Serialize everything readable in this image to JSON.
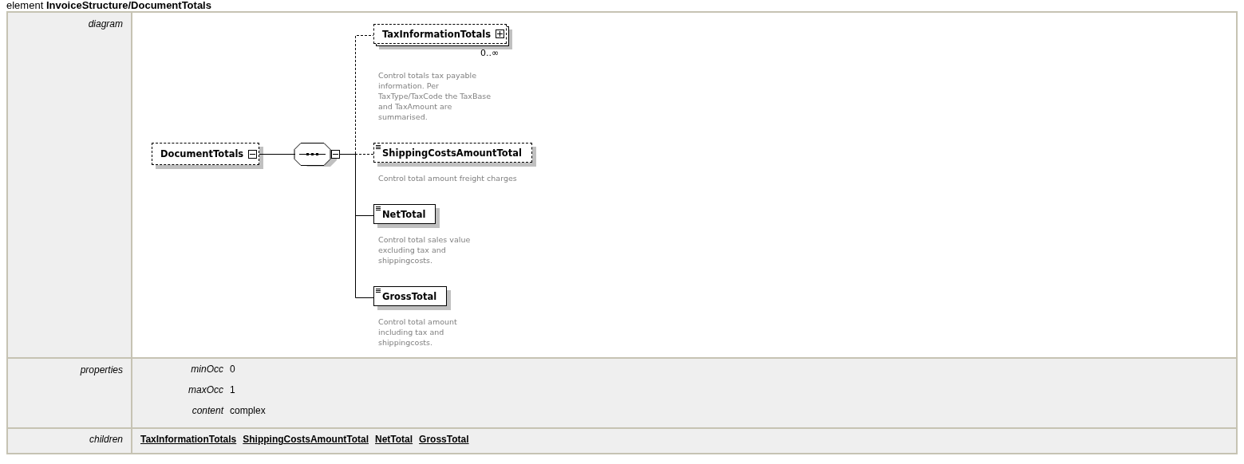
{
  "heading": {
    "prefix": "element",
    "path": "InvoiceStructure/DocumentTotals"
  },
  "diagram": {
    "label": "diagram",
    "root": {
      "name": "DocumentTotals",
      "optional": true,
      "expanded": true
    },
    "compositor": {
      "kind": "sequence",
      "expanded": true
    },
    "children": [
      {
        "name": "TaxInformationTotals",
        "kind": "complex",
        "optional": true,
        "multiple": true,
        "occurs": "0..∞",
        "description": [
          "Control totals tax payable",
          "information. Per",
          "TaxType/TaxCode the TaxBase",
          "and TaxAmount are",
          "summarised."
        ]
      },
      {
        "name": "ShippingCostsAmountTotal",
        "kind": "simple",
        "optional": true,
        "multiple": false,
        "description": [
          "Control total amount freight charges"
        ]
      },
      {
        "name": "NetTotal",
        "kind": "simple",
        "optional": false,
        "multiple": false,
        "description": [
          "Control total sales value",
          "excluding tax and",
          "shippingcosts."
        ]
      },
      {
        "name": "GrossTotal",
        "kind": "simple",
        "optional": false,
        "multiple": false,
        "description": [
          "Control total amount",
          "including tax and",
          "shippingcosts."
        ]
      }
    ]
  },
  "properties": {
    "label": "properties",
    "items": [
      {
        "name": "minOcc",
        "value": "0"
      },
      {
        "name": "maxOcc",
        "value": "1"
      },
      {
        "name": "content",
        "value": "complex"
      }
    ]
  },
  "children_row": {
    "label": "children",
    "links": [
      "TaxInformationTotals",
      "ShippingCostsAmountTotal",
      "NetTotal",
      "GrossTotal"
    ]
  }
}
